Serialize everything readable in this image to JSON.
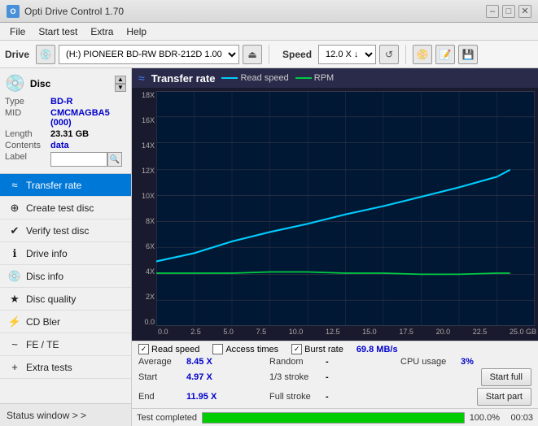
{
  "titlebar": {
    "title": "Opti Drive Control 1.70",
    "icon": "O",
    "minimize": "–",
    "maximize": "□",
    "close": "✕"
  },
  "menubar": {
    "items": [
      "File",
      "Start test",
      "Extra",
      "Help"
    ]
  },
  "toolbar": {
    "drive_label": "Drive",
    "drive_value": "(H:)  PIONEER BD-RW  BDR-212D 1.00",
    "speed_label": "Speed",
    "speed_value": "12.0 X ↓"
  },
  "disc": {
    "type_key": "Type",
    "type_val": "BD-R",
    "mid_key": "MID",
    "mid_val": "CMCMAGBA5 (000)",
    "length_key": "Length",
    "length_val": "23.31 GB",
    "contents_key": "Contents",
    "contents_val": "data",
    "label_key": "Label",
    "label_val": ""
  },
  "nav": {
    "items": [
      {
        "id": "transfer-rate",
        "label": "Transfer rate",
        "icon": "≈",
        "active": true
      },
      {
        "id": "create-test-disc",
        "label": "Create test disc",
        "icon": "⊕",
        "active": false
      },
      {
        "id": "verify-test-disc",
        "label": "Verify test disc",
        "icon": "✔",
        "active": false
      },
      {
        "id": "drive-info",
        "label": "Drive info",
        "icon": "ℹ",
        "active": false
      },
      {
        "id": "disc-info",
        "label": "Disc info",
        "icon": "💿",
        "active": false
      },
      {
        "id": "disc-quality",
        "label": "Disc quality",
        "icon": "★",
        "active": false
      },
      {
        "id": "cd-bler",
        "label": "CD Bler",
        "icon": "⚡",
        "active": false
      },
      {
        "id": "fe-te",
        "label": "FE / TE",
        "icon": "~",
        "active": false
      },
      {
        "id": "extra-tests",
        "label": "Extra tests",
        "icon": "+",
        "active": false
      }
    ],
    "status_window": "Status window > >"
  },
  "chart": {
    "title": "Transfer rate",
    "legend": [
      {
        "id": "read-speed",
        "label": "Read speed",
        "color": "#00ccff"
      },
      {
        "id": "rpm",
        "label": "RPM",
        "color": "#00cc44"
      }
    ],
    "y_labels": [
      "18X",
      "16X",
      "14X",
      "12X",
      "10X",
      "8X",
      "6X",
      "4X",
      "2X",
      "0.0"
    ],
    "x_labels": [
      "0.0",
      "2.5",
      "5.0",
      "7.5",
      "10.0",
      "12.5",
      "15.0",
      "17.5",
      "20.0",
      "22.5",
      "25.0 GB"
    ]
  },
  "stats": {
    "legend_items": [
      {
        "id": "read-speed-check",
        "label": "Read speed",
        "checked": true
      },
      {
        "id": "access-times-check",
        "label": "Access times",
        "checked": false
      },
      {
        "id": "burst-rate-check",
        "label": "Burst rate",
        "checked": true
      },
      {
        "id": "burst-rate-val",
        "label": "69.8 MB/s"
      }
    ],
    "rows": [
      {
        "cells": [
          {
            "key": "Average",
            "val": "8.45 X",
            "val_color": "blue"
          },
          {
            "key": "Random",
            "val": "-",
            "val_color": "black"
          },
          {
            "key": "CPU usage",
            "val": "3%",
            "val_color": "blue"
          }
        ]
      },
      {
        "cells": [
          {
            "key": "Start",
            "val": "4.97 X",
            "val_color": "blue"
          },
          {
            "key": "1/3 stroke",
            "val": "-",
            "val_color": "black"
          },
          {
            "button": "Start full"
          }
        ]
      },
      {
        "cells": [
          {
            "key": "End",
            "val": "11.95 X",
            "val_color": "blue"
          },
          {
            "key": "Full stroke",
            "val": "-",
            "val_color": "black"
          },
          {
            "button": "Start part"
          }
        ]
      }
    ]
  },
  "progress": {
    "status_text": "Test completed",
    "percent": 100,
    "percent_label": "100.0%",
    "time": "00:03"
  }
}
